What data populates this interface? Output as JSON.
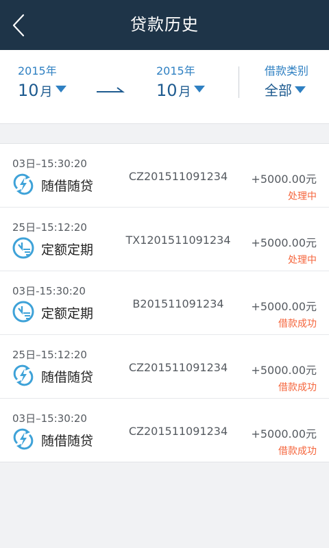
{
  "header": {
    "title": "贷款历史",
    "back_icon": "chevron-left-icon"
  },
  "filter": {
    "start": {
      "year": "2015年",
      "month": "10",
      "month_unit": "月"
    },
    "end": {
      "year": "2015年",
      "month": "10",
      "month_unit": "月"
    },
    "category": {
      "label": "借款类别",
      "value": "全部"
    }
  },
  "colors": {
    "header_bg": "#1e3448",
    "accent": "#2f80c2",
    "status": "#f5653c"
  },
  "records": [
    {
      "time": "03日–15:30:20",
      "type": "随借随贷",
      "icon": "lightning-refresh-icon",
      "code": "CZ201511091234",
      "amount": "+5000.00元",
      "status": "处理中"
    },
    {
      "time": "25日–15:12:20",
      "type": "定额定期",
      "icon": "clock-list-icon",
      "code": "TX1201511091234",
      "amount": "+5000.00元",
      "status": "处理中"
    },
    {
      "time": "03日-15:30:20",
      "type": "定额定期",
      "icon": "clock-list-icon",
      "code": "B201511091234",
      "amount": "+5000.00元",
      "status": "借款成功"
    },
    {
      "time": "25日–15:12:20",
      "type": "随借随贷",
      "icon": "lightning-refresh-icon",
      "code": "CZ201511091234",
      "amount": "+5000.00元",
      "status": "借款成功"
    },
    {
      "time": "03日–15:30:20",
      "type": "随借随贷",
      "icon": "lightning-refresh-icon",
      "code": "CZ201511091234",
      "amount": "+5000.00元",
      "status": "借款成功"
    }
  ]
}
